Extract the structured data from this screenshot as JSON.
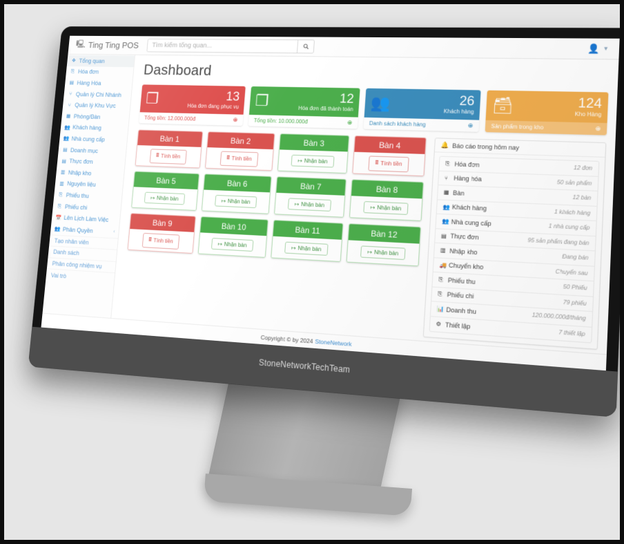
{
  "navbar": {
    "brand": "Ting Ting POS",
    "brand_icon": "desktop-icon",
    "search_placeholder": "Tìm kiếm tổng quan...",
    "search_value": "",
    "search_icon": "search-icon",
    "user_icon": "user-icon",
    "caret_icon": "caret-down-icon"
  },
  "sidebar": {
    "items": [
      {
        "label": "Tổng quan",
        "icon": "dashboard-icon",
        "active": true
      },
      {
        "label": "Hóa đơn",
        "icon": "invoice-icon",
        "active": false
      },
      {
        "label": "Hàng Hóa",
        "icon": "goods-icon",
        "active": false
      },
      {
        "label": "Quản lý Chi Nhánh",
        "icon": "sitemap-icon",
        "active": false
      },
      {
        "label": "Quản lý Khu Vực",
        "icon": "sitemap-icon",
        "active": false
      },
      {
        "label": "Phòng/Bàn",
        "icon": "table-icon",
        "active": false
      },
      {
        "label": "Khách hàng",
        "icon": "users-icon",
        "active": false
      },
      {
        "label": "Nhà cung cấp",
        "icon": "users-icon",
        "active": false
      },
      {
        "label": "Doanh mục",
        "icon": "list-icon",
        "active": false
      },
      {
        "label": "Thực đơn",
        "icon": "menu-icon",
        "active": false
      },
      {
        "label": "Nhập kho",
        "icon": "warehouse-icon",
        "active": false
      },
      {
        "label": "Nguyên liệu",
        "icon": "warehouse-icon",
        "active": false
      },
      {
        "label": "Phiếu thu",
        "icon": "receipt-icon",
        "active": false
      },
      {
        "label": "Phiếu chi",
        "icon": "receipt-icon",
        "active": false
      },
      {
        "label": "Lên Lịch Làm Việc",
        "icon": "calendar-icon",
        "active": false
      },
      {
        "label": "Phân Quyền",
        "icon": "users-icon",
        "active": false,
        "caret": "chevron-left-icon"
      }
    ],
    "subitems": [
      {
        "label": "Tạo nhân viên"
      },
      {
        "label": "Danh sách"
      },
      {
        "label": "Phân công nhiệm vụ"
      },
      {
        "label": "Vai trò"
      }
    ]
  },
  "main": {
    "title": "Dashboard",
    "stats": [
      {
        "value": "13",
        "label": "Hóa đơn đang phục vụ",
        "footer": "Tổng tiền: 12.000.000đ",
        "icon": "copy-files-icon",
        "footer_icon": "arrow-circle-right-icon",
        "color": "red",
        "hex": "#dd4b49"
      },
      {
        "value": "12",
        "label": "Hóa đơn đã thành toán",
        "footer": "Tổng tiền: 10.000.000đ",
        "icon": "copy-files-icon",
        "footer_icon": "arrow-circle-right-icon",
        "color": "green",
        "hex": "#4cae4c"
      },
      {
        "value": "26",
        "label": "Khách hàng",
        "footer": "Danh sách khách hàng",
        "icon": "users-group-icon",
        "footer_icon": "arrow-circle-right-icon",
        "color": "blue",
        "hex": "#3c8dbc"
      },
      {
        "value": "124",
        "label": "Kho Hàng",
        "footer": "Sản phẩm trong kho",
        "icon": "database-icon",
        "footer_icon": "arrow-circle-right-icon",
        "color": "orange",
        "hex": "#f0ad4e"
      }
    ],
    "tables": [
      {
        "name": "Bàn 1",
        "state": "red",
        "action": "Tính tiền",
        "action_icon": "calculator-icon"
      },
      {
        "name": "Bàn 2",
        "state": "red",
        "action": "Tính tiền",
        "action_icon": "calculator-icon"
      },
      {
        "name": "Bàn 3",
        "state": "green",
        "action": "Nhận bàn",
        "action_icon": "sign-in-icon"
      },
      {
        "name": "Bàn 4",
        "state": "red",
        "action": "Tính tiền",
        "action_icon": "calculator-icon"
      },
      {
        "name": "Bàn 5",
        "state": "green",
        "action": "Nhận bàn",
        "action_icon": "sign-in-icon"
      },
      {
        "name": "Bàn 6",
        "state": "green",
        "action": "Nhận bàn",
        "action_icon": "sign-in-icon"
      },
      {
        "name": "Bàn 7",
        "state": "green",
        "action": "Nhận bàn",
        "action_icon": "sign-in-icon"
      },
      {
        "name": "Bàn 8",
        "state": "green",
        "action": "Nhận bàn",
        "action_icon": "sign-in-icon"
      },
      {
        "name": "Bàn 9",
        "state": "red",
        "action": "Tính tiền",
        "action_icon": "calculator-icon"
      },
      {
        "name": "Bàn 10",
        "state": "green",
        "action": "Nhận bàn",
        "action_icon": "sign-in-icon"
      },
      {
        "name": "Bàn 11",
        "state": "green",
        "action": "Nhận bàn",
        "action_icon": "sign-in-icon"
      },
      {
        "name": "Bàn 12",
        "state": "green",
        "action": "Nhận bàn",
        "action_icon": "sign-in-icon"
      }
    ],
    "report": {
      "title": "Báo cáo trong hôm nay",
      "title_icon": "bell-icon",
      "rows": [
        {
          "label": "Hóa đơn",
          "value": "12 đơn",
          "icon": "invoice-icon"
        },
        {
          "label": "Hàng hóa",
          "value": "50 sản phẩm",
          "icon": "sitemap-icon"
        },
        {
          "label": "Bàn",
          "value": "12 bàn",
          "icon": "table-icon"
        },
        {
          "label": "Khách hàng",
          "value": "1 khách hàng",
          "icon": "users-icon"
        },
        {
          "label": "Nhà cung cấp",
          "value": "1 nhà cung cấp",
          "icon": "users-icon"
        },
        {
          "label": "Thực đơn",
          "value": "95 sản phẩm đang bán",
          "icon": "menu-icon"
        },
        {
          "label": "Nhập kho",
          "value": "Đang bán",
          "icon": "warehouse-icon"
        },
        {
          "label": "Chuyển kho",
          "value": "Chuyển sau",
          "icon": "truck-icon"
        },
        {
          "label": "Phiếu thu",
          "value": "50 Phiếu",
          "icon": "receipt-icon"
        },
        {
          "label": "Phiếu chi",
          "value": "79 phiếu",
          "icon": "receipt-icon"
        },
        {
          "label": "Doanh thu",
          "value": "120.000.000đ/tháng",
          "icon": "chart-bar-icon"
        },
        {
          "label": "Thiết lập",
          "value": "7 thiết lập",
          "icon": "gears-icon"
        }
      ]
    }
  },
  "footer": {
    "copyright": "Copyright © by 2024",
    "brand": "StoneNetwork"
  },
  "device": {
    "bezel_label": "StoneNetworkTechTeam"
  }
}
